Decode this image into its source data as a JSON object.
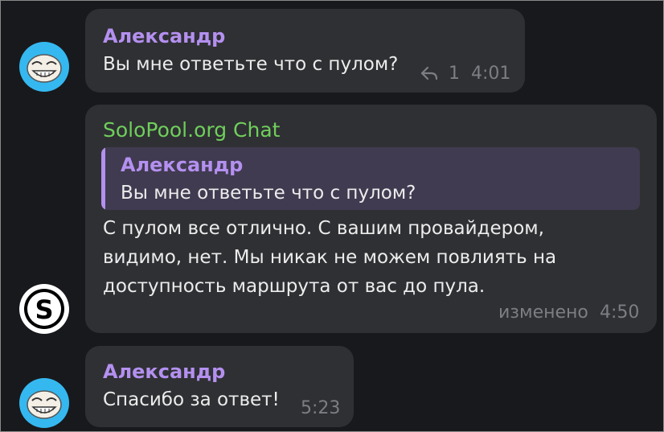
{
  "messages": [
    {
      "author": "Александр",
      "text": "Вы мне ответьте что с пулом?",
      "reply_count": "1",
      "time": "4:01",
      "avatar_icon": "troll-face-avatar"
    },
    {
      "author": "SoloPool.org Chat",
      "quote": {
        "author": "Александр",
        "text": "Вы мне ответьте что с пулом?"
      },
      "lines": [
        "С пулом все отлично. С вашим провайдером,",
        "видимо, нет. Мы никак не можем повлиять на",
        "доступность маршрута от вас до пула."
      ],
      "edited_label": "изменено",
      "time": "4:50",
      "avatar_icon": "solopool-logo-avatar",
      "avatar_letter": "S"
    },
    {
      "author": "Александр",
      "text": "Спасибо за ответ!",
      "time": "5:23",
      "avatar_icon": "troll-face-avatar"
    }
  ],
  "colors": {
    "background": "#18191d",
    "bubble": "#2f3033",
    "author_purple": "#b490f0",
    "author_green": "#6fcf5c",
    "quote_bg": "#403b50",
    "meta": "#7c7e84"
  }
}
